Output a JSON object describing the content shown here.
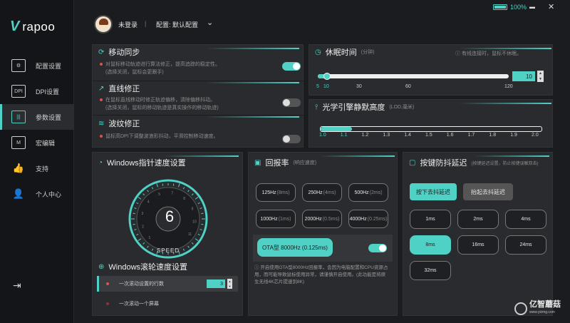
{
  "brand": {
    "mark": "V",
    "name": "rapoo"
  },
  "sidebar": {
    "items": [
      {
        "label": "配置设置",
        "icon": "profile-settings-icon",
        "glyph": "⚙"
      },
      {
        "label": "DPI设置",
        "icon": "dpi-icon",
        "glyph": "DPI"
      },
      {
        "label": "参数设置",
        "icon": "parameter-icon",
        "glyph": "|||"
      },
      {
        "label": "宏编辑",
        "icon": "macro-icon",
        "glyph": "M"
      },
      {
        "label": "支持",
        "icon": "thumbs-up-icon",
        "glyph": "👍"
      },
      {
        "label": "个人中心",
        "icon": "user-icon",
        "glyph": "👤"
      }
    ],
    "active_index": 2,
    "collapse_glyph": "⇥"
  },
  "header": {
    "login": "未登录",
    "separator": "|",
    "config": "配置: 默认配置",
    "chevron": "⌄"
  },
  "window": {
    "battery": "100%",
    "battery_level": 1.0,
    "minimize": "▬",
    "close": "✕"
  },
  "motion_sync": {
    "title": "移动同步",
    "desc": "对鼠标移动轨迹进行算法修正，提高追踪的稳定性。",
    "desc2": "(选择关闭，鼠标会更跟手)",
    "enabled": true
  },
  "angle_snap": {
    "title": "直线修正",
    "desc": "在鼠标直线移动时修正轨迹偏移，清除偏移抖动。",
    "desc2": "(选择关闭，鼠标的移动轨迹是真实操作的移动轨迹)",
    "enabled": false
  },
  "ripple": {
    "title": "波纹修正",
    "desc": "鼠标高DPI下调整波浪形抖动，平滑控制移动速度。",
    "enabled": false
  },
  "sleep": {
    "title": "休眠时间",
    "unit": "(分钟)",
    "note": "有线连接时，鼠标不休眠。",
    "value": "10",
    "min": 5,
    "max": 120,
    "current": 10,
    "ticks": [
      "5",
      "10",
      "30",
      "60",
      "120"
    ],
    "up": "▲",
    "down": "▼"
  },
  "lod": {
    "title": "光学引擎静默高度",
    "unit": "(LOD,毫米)",
    "current": 1.1,
    "ticks": [
      "1.0",
      "1.1",
      "1.2",
      "1.3",
      "1.4",
      "1.5",
      "1.6",
      "1.7",
      "1.8",
      "1.9",
      "2.0"
    ]
  },
  "pointer": {
    "title": "Windows指针速度设置",
    "value": "6",
    "speed_label": "SPEED",
    "dial_ticks": [
      "1",
      "2",
      "3",
      "4",
      "5",
      "7",
      "8",
      "9",
      "10",
      "11"
    ]
  },
  "scroll": {
    "title": "Windows滚轮速度设置",
    "opt1": "一次滚动设置的行数",
    "opt1_value": "3",
    "opt2": "一次滚动一个屏幕"
  },
  "polling": {
    "title": "回报率",
    "subtitle": "(响应速度)",
    "options": [
      {
        "rate": "125Hz",
        "ms": "(8ms)"
      },
      {
        "rate": "250Hz",
        "ms": "(4ms)"
      },
      {
        "rate": "500Hz",
        "ms": "(2ms)"
      },
      {
        "rate": "1000Hz",
        "ms": "(1ms)"
      },
      {
        "rate": "2000Hz",
        "ms": "(0.5ms)"
      },
      {
        "rate": "4000Hz",
        "ms": "(0.25ms)"
      }
    ],
    "ota_label": "OTA型 8000Hz (0.125ms)",
    "ota_enabled": true,
    "ota_note": "开启使用OTA型8000Hz回报率，会因为电脑配置和CPU资源占用，而可能导致鼠标使用异常，请谨慎开启使用。(此功能是将原生无线4K芯片提速到8K)"
  },
  "debounce": {
    "title": "按键防抖延迟",
    "subtitle": "(按键延迟设置，防止按键误触双击)",
    "press": "按下去抖延迟",
    "release": "抬起去抖延迟",
    "options": [
      "1ms",
      "2ms",
      "4ms",
      "8ms",
      "16ms",
      "24ms",
      "32ms"
    ],
    "selected": "8ms"
  },
  "watermark": {
    "name": "亿智蘑菇",
    "url": "www.yizmg.com"
  },
  "colors": {
    "accent": "#4fd1c5",
    "background": "#1b1c1f",
    "panel": "#2a2b2f",
    "alert": "#e05252"
  }
}
